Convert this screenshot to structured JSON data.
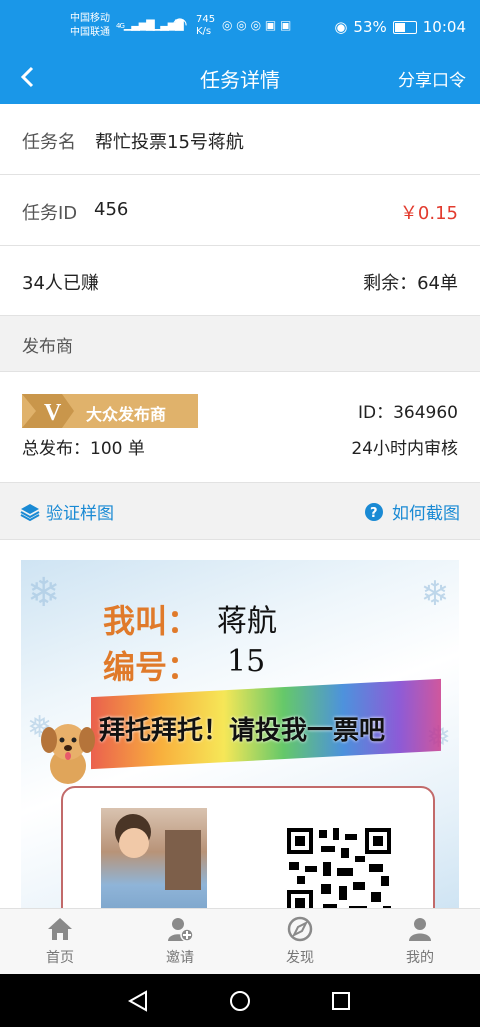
{
  "status": {
    "carrier1": "中国移动",
    "carrier2": "中国联通",
    "sig1": "4G",
    "sig2": "3G",
    "speed": "745\nK/s",
    "battery_pct": "53%",
    "time": "10:04"
  },
  "nav": {
    "title": "任务详情",
    "share": "分享口令",
    "back_icon": "chevron-left"
  },
  "task": {
    "name_label": "任务名",
    "name_value": "帮忙投票15号蒋航",
    "id_label": "任务ID",
    "id_value": "456",
    "reward": "￥0.15",
    "earned": "34人已赚",
    "remaining": "剩余：64单"
  },
  "publisher": {
    "section_label": "发布商",
    "badge": "大众发布商",
    "id": "ID：364960",
    "total": "总发布：100 单",
    "review": "24小时内审核"
  },
  "verify": {
    "sample_label": "验证样图",
    "howto_label": "如何截图"
  },
  "sample_image": {
    "line1_key": "我叫：",
    "line1_val": "蒋航",
    "line2_key": "编号：",
    "line2_val": "15",
    "banner": "拜托拜托！请投我一票吧"
  },
  "tabs": [
    {
      "label": "首页",
      "icon": "home-icon"
    },
    {
      "label": "邀请",
      "icon": "invite-icon"
    },
    {
      "label": "发现",
      "icon": "discover-icon"
    },
    {
      "label": "我的",
      "icon": "profile-icon"
    }
  ],
  "colors": {
    "primary": "#1a97e8",
    "reward": "#e23b2e",
    "badge": "#e0b26b",
    "link": "#1a8ad4"
  }
}
